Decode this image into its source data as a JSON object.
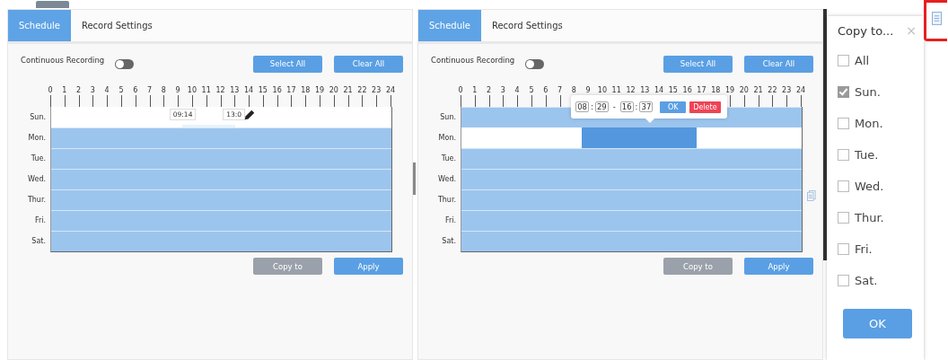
{
  "panels": [
    {
      "tabs": [
        {
          "label": "Schedule",
          "selected": true
        },
        {
          "label": "Record Settings",
          "selected": false
        }
      ],
      "continuous_recording": {
        "label": "Continuous Recording",
        "on": false
      },
      "top_buttons": [
        "Select All",
        "Clear All"
      ],
      "hours": [
        "0",
        "1",
        "2",
        "3",
        "4",
        "5",
        "6",
        "7",
        "8",
        "9",
        "10",
        "11",
        "12",
        "13",
        "14",
        "15",
        "16",
        "17",
        "18",
        "19",
        "20",
        "21",
        "22",
        "23",
        "24"
      ],
      "days": [
        {
          "label": "Sun.",
          "kind": "empty"
        },
        {
          "label": "Mon.",
          "kind": "full"
        },
        {
          "label": "Tue.",
          "kind": "full"
        },
        {
          "label": "Wed.",
          "kind": "full"
        },
        {
          "label": "Thur.",
          "kind": "full"
        },
        {
          "label": "Fri.",
          "kind": "full"
        },
        {
          "label": "Sat.",
          "kind": "full"
        }
      ],
      "drag_selection": {
        "start": "09:14",
        "end": "13:0"
      },
      "copy_button": {
        "label": "Copy to",
        "disabled": true
      },
      "apply_button": {
        "label": "Apply"
      }
    },
    {
      "tabs": [
        {
          "label": "Schedule",
          "selected": true
        },
        {
          "label": "Record Settings",
          "selected": false
        }
      ],
      "continuous_recording": {
        "label": "Continuous Recording",
        "on": false
      },
      "top_buttons": [
        "Select All",
        "Clear All"
      ],
      "hours": [
        "0",
        "1",
        "2",
        "3",
        "4",
        "5",
        "6",
        "7",
        "8",
        "9",
        "10",
        "11",
        "12",
        "13",
        "14",
        "15",
        "16",
        "17",
        "18",
        "19",
        "20",
        "21",
        "22",
        "23",
        "24"
      ],
      "days": [
        {
          "label": "Sun.",
          "kind": "full"
        },
        {
          "label": "Mon.",
          "kind": "partial"
        },
        {
          "label": "Tue.",
          "kind": "full"
        },
        {
          "label": "Wed.",
          "kind": "full"
        },
        {
          "label": "Thur.",
          "kind": "full"
        },
        {
          "label": "Fri.",
          "kind": "full"
        },
        {
          "label": "Sat.",
          "kind": "full"
        }
      ],
      "time_editor": {
        "start_hour": "08",
        "start_minute": "29",
        "end_hour": "16",
        "end_minute": "37",
        "time_separator": ":",
        "range_separator": "-",
        "ok": "OK",
        "delete": "Delete"
      },
      "copy_button": {
        "label": "Copy to",
        "disabled": true
      },
      "apply_button": {
        "label": "Apply"
      }
    }
  ],
  "copy_dialog": {
    "title": "Copy to...",
    "close": "×",
    "options": [
      {
        "label": "All",
        "checked": false
      },
      {
        "label": "Sun.",
        "checked": true
      },
      {
        "label": "Mon.",
        "checked": false
      },
      {
        "label": "Tue.",
        "checked": false
      },
      {
        "label": "Wed.",
        "checked": false
      },
      {
        "label": "Thur.",
        "checked": false
      },
      {
        "label": "Fri.",
        "checked": false
      },
      {
        "label": "Sat.",
        "checked": false
      }
    ],
    "ok": "OK"
  }
}
